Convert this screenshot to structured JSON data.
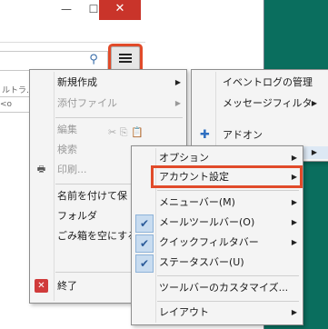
{
  "window": {
    "minimize_icon": "minimize-icon",
    "maximize_icon": "maximize-icon",
    "close_icon": "close-icon"
  },
  "toolbar": {
    "search_icon": "search-icon",
    "menu_icon": "hamburger-menu-icon"
  },
  "list": {
    "partial_text": "ルトラ…",
    "partial_cell": "<o"
  },
  "main_menu": [
    {
      "label": "新規作成",
      "disabled": false,
      "submenu": true
    },
    {
      "label": "添付ファイル",
      "disabled": true,
      "submenu": true
    },
    {
      "label": "編集",
      "disabled": true,
      "submenu": false
    },
    {
      "label": "検索",
      "disabled": true,
      "submenu": true
    },
    {
      "label": "印刷...",
      "disabled": true,
      "submenu": false
    },
    {
      "label": "名前を付けて保",
      "disabled": false,
      "submenu": true
    },
    {
      "label": "フォルダ",
      "disabled": false,
      "submenu": true
    },
    {
      "label": "ごみ箱を空にする",
      "disabled": false,
      "submenu": false
    },
    {
      "label": "終了",
      "disabled": false,
      "submenu": false
    }
  ],
  "tools_menu": [
    {
      "label": "イベントログの管理"
    },
    {
      "label": "メッセージフィルタ"
    },
    {
      "label": "アドオン"
    }
  ],
  "options_menu": [
    {
      "label": "オプション",
      "checked": false,
      "submenu": true
    },
    {
      "label": "アカウント設定",
      "checked": false,
      "submenu": true
    },
    {
      "label": "メニューバー(M)",
      "checked": false,
      "submenu": true
    },
    {
      "label": "メールツールバー(O)",
      "checked": true,
      "submenu": true
    },
    {
      "label": "クイックフィルタバー",
      "checked": true,
      "submenu": true
    },
    {
      "label": "ステータスバー(U)",
      "checked": true,
      "submenu": false
    },
    {
      "label": "ツールバーのカスタマイズ...",
      "checked": false,
      "submenu": false
    },
    {
      "label": "レイアウト",
      "checked": false,
      "submenu": true
    }
  ],
  "colors": {
    "highlight": "#e14b2a",
    "background": "#0a6e5e",
    "menu": "#f4f4f4"
  }
}
